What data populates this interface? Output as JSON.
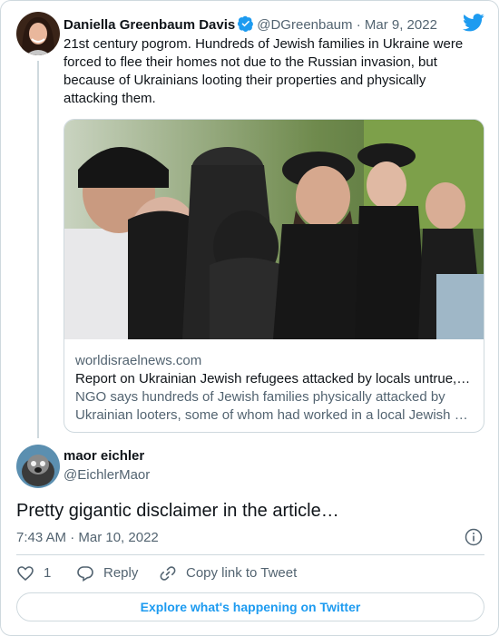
{
  "tweet1": {
    "author_name": "Daniella Greenbaum Davis",
    "handle": "@DGreenbaum",
    "separator": "·",
    "date": "Mar 9, 2022",
    "text": "21st century pogrom. Hundreds of Jewish families in Ukraine were forced to flee their homes not due to the Russian invasion, but because of Ukrainians looting their properties and physically attacking them.",
    "link_card": {
      "domain": "worldisraelnews.com",
      "title": "Report on Ukrainian Jewish refugees attacked by locals untrue,…",
      "description_line1": "NGO says hundreds of Jewish families physically attacked by",
      "description_line2": "Ukrainian looters, some of whom had worked in a local Jewish …"
    }
  },
  "tweet2": {
    "author_name": "maor eichler",
    "handle": "@EichlerMaor",
    "text": "Pretty gigantic disclaimer in the article…",
    "timestamp": "7:43 AM · Mar 10, 2022"
  },
  "actions": {
    "like_count": "1",
    "reply_label": "Reply",
    "copy_link_label": "Copy link to Tweet"
  },
  "explore_label": "Explore what's happening on Twitter",
  "colors": {
    "accent": "#1d9bf0",
    "muted": "#536471",
    "border": "#cfd9de",
    "text": "#0f1419"
  },
  "icons": [
    "twitter-bird-icon",
    "verified-badge-icon",
    "info-icon",
    "heart-icon",
    "reply-bubble-icon",
    "link-icon"
  ]
}
